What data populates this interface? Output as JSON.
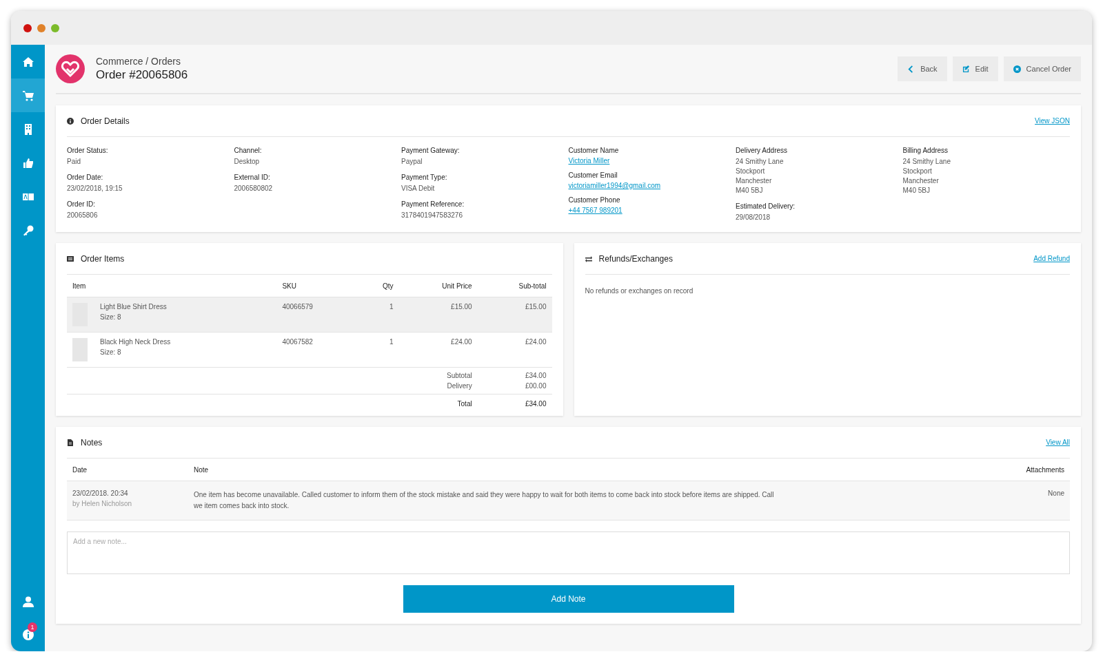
{
  "window": {
    "controls": [
      {
        "color": "#d0120f"
      },
      {
        "color": "#e0822a"
      },
      {
        "color": "#7cbb2a"
      }
    ]
  },
  "sidebar": {
    "items": [
      {
        "kind": "home",
        "selected": false
      },
      {
        "kind": "cart",
        "selected": true
      },
      {
        "kind": "building",
        "selected": false
      },
      {
        "kind": "thumb",
        "selected": false
      },
      {
        "kind": "translate",
        "selected": false
      },
      {
        "kind": "key",
        "selected": false
      }
    ],
    "bottom": [
      {
        "kind": "user"
      },
      {
        "kind": "info",
        "badge": "1"
      }
    ]
  },
  "header": {
    "breadcrumb": "Commerce / Orders",
    "title": "Order #20065806",
    "buttons": [
      {
        "kind": "back",
        "label": "Back"
      },
      {
        "kind": "edit",
        "label": "Edit"
      },
      {
        "kind": "cancel",
        "label": "Cancel Order"
      }
    ]
  },
  "order_details": {
    "title": "Order Details",
    "link": "View JSON",
    "columns": [
      [
        {
          "label": "Order Status:",
          "kind": "text",
          "lines": [
            "Paid"
          ]
        },
        {
          "label": "Order Date:",
          "kind": "text",
          "lines": [
            "23/02/2018, 19:15"
          ]
        },
        {
          "label": "Order ID:",
          "kind": "text",
          "lines": [
            "20065806"
          ]
        }
      ],
      [
        {
          "label": "Channel:",
          "kind": "text",
          "lines": [
            "Desktop"
          ]
        },
        {
          "label": "External ID:",
          "kind": "text",
          "lines": [
            "2006580802"
          ]
        }
      ],
      [
        {
          "label": "Payment Gateway:",
          "kind": "text",
          "lines": [
            "Paypal"
          ]
        },
        {
          "label": "Payment Type:",
          "kind": "text",
          "lines": [
            "VISA Debit"
          ]
        },
        {
          "label": "Payment Reference:",
          "kind": "text",
          "lines": [
            "3178401947583276"
          ]
        }
      ],
      [
        {
          "label": "Customer Name",
          "kind": "link",
          "lines": [
            "Victoria Miller"
          ]
        },
        {
          "label": "Customer Email",
          "kind": "link",
          "lines": [
            "victoriamiller1994@gmail.com"
          ]
        },
        {
          "label": "Customer Phone",
          "kind": "link",
          "lines": [
            "+44 7567 989201"
          ]
        }
      ],
      [
        {
          "label": "Delivery Address",
          "kind": "text",
          "lines": [
            "24 Smithy Lane",
            "Stockport",
            "Manchester",
            "M40 5BJ"
          ]
        },
        {
          "label": "Estimated Delivery:",
          "kind": "text",
          "lines": [
            "29/08/2018"
          ]
        }
      ],
      [
        {
          "label": "Billing Address",
          "kind": "text",
          "lines": [
            "24 Smithy Lane",
            "Stockport",
            "Manchester",
            "M40 5BJ"
          ]
        }
      ]
    ]
  },
  "order_items": {
    "title": "Order Items",
    "columns": [
      "Item",
      "SKU",
      "Qty",
      "Unit Price",
      "Sub-total"
    ],
    "rows": [
      {
        "name": "Light Blue Shirt Dress",
        "size": "Size: 8",
        "sku": "40066579",
        "qty": "1",
        "unit_price": "£15.00",
        "subtotal": "£15.00",
        "selected": true
      },
      {
        "name": "Black High Neck Dress",
        "size": "Size: 8",
        "sku": "40067582",
        "qty": "1",
        "unit_price": "£24.00",
        "subtotal": "£24.00",
        "selected": false
      }
    ],
    "summary": [
      {
        "label": "Subtotal",
        "value": "£34.00"
      },
      {
        "label": "Delivery",
        "value": "£00.00"
      }
    ],
    "total": {
      "label": "Total",
      "value": "£34.00"
    }
  },
  "refunds": {
    "title": "Refunds/Exchanges",
    "link": "Add Refund",
    "message": "No refunds or exchanges on record"
  },
  "notes": {
    "title": "Notes",
    "link": "View All",
    "columns": [
      "Date",
      "Note",
      "Attachments"
    ],
    "rows": [
      {
        "date": "23/02/2018. 20:34",
        "author": "by Helen Nicholson",
        "note": "One item has become unavailable. Called customer to inform them of the stock mistake and said they were happy to wait for both items to come back into stock before items are shipped. Call we item comes back into stock.",
        "attachments": "None"
      }
    ],
    "input": {
      "placeholder": "Add a new note..."
    },
    "button": "Add Note"
  }
}
